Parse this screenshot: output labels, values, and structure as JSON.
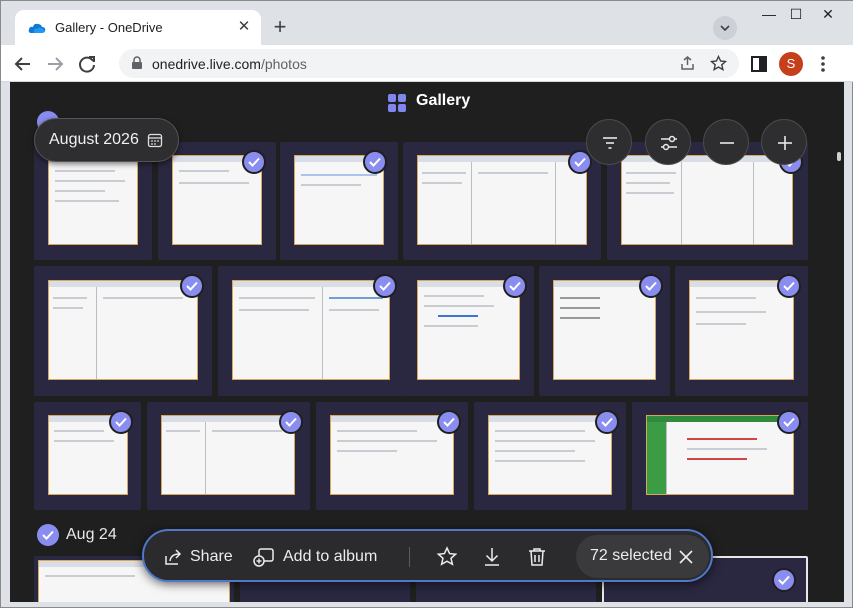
{
  "browser": {
    "tab_title": "Gallery - OneDrive",
    "tab_close": "✕",
    "new_tab": "+",
    "url_host": "onedrive.live.com",
    "url_path": "/photos",
    "profile_initial": "S",
    "window_controls": {
      "minimize": "—",
      "maximize": "☐",
      "close": "✕"
    }
  },
  "page": {
    "title": "Gallery",
    "date_pill": "August 2026",
    "second_group_label": "Aug 24",
    "accent_color": "#8a8df0"
  },
  "action_bar": {
    "share": "Share",
    "add_to_album": "Add to album",
    "selected": "72 selected"
  }
}
